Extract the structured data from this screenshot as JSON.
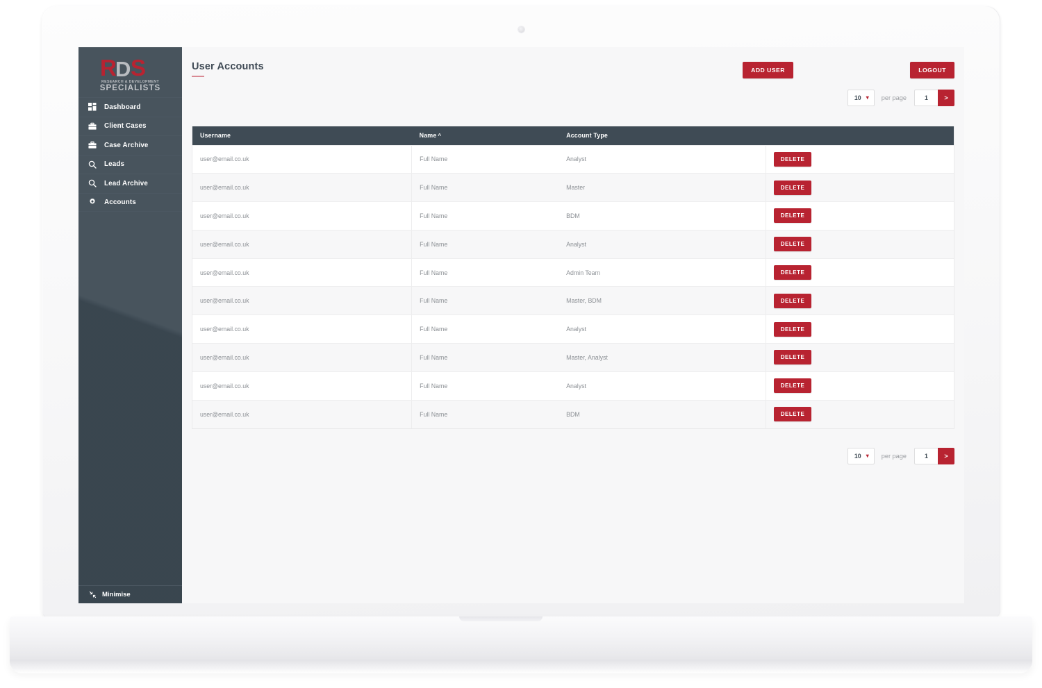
{
  "brand": {
    "logo_letters": "RDS",
    "tagline_line1": "RESEARCH & DEVELOPMENT",
    "tagline_line2": "SPECIALISTS",
    "red": "#b82331",
    "gray": "#b9bcc0",
    "sidebar_bg": "#3d4a54"
  },
  "sidebar": {
    "items": [
      {
        "label": "Dashboard",
        "icon": "grid-icon"
      },
      {
        "label": "Client Cases",
        "icon": "briefcase-icon"
      },
      {
        "label": "Case Archive",
        "icon": "briefcase-icon"
      },
      {
        "label": "Leads",
        "icon": "search-icon"
      },
      {
        "label": "Lead Archive",
        "icon": "search-icon"
      },
      {
        "label": "Accounts",
        "icon": "gear-icon"
      }
    ],
    "minimise_label": "Minimise",
    "minimise_icon": "collapse-arrows-icon"
  },
  "header": {
    "title": "User Accounts",
    "add_user_label": "ADD USER",
    "logout_label": "LOGOUT"
  },
  "pagination": {
    "per_page_value": "10",
    "per_page_label": "per page",
    "page_value": "1",
    "next_label": ">",
    "chevron_icon": "chevron-down-icon"
  },
  "table": {
    "columns": [
      {
        "label": "Username",
        "sorted": false
      },
      {
        "label": "Name",
        "sorted": true,
        "sort_caret": "^"
      },
      {
        "label": "Account Type",
        "sorted": false
      },
      {
        "label": "",
        "sorted": false
      }
    ],
    "delete_label": "DELETE",
    "rows": [
      {
        "username": "user@email.co.uk",
        "name": "Full Name",
        "type": "Analyst"
      },
      {
        "username": "user@email.co.uk",
        "name": "Full Name",
        "type": "Master"
      },
      {
        "username": "user@email.co.uk",
        "name": "Full Name",
        "type": "BDM"
      },
      {
        "username": "user@email.co.uk",
        "name": "Full Name",
        "type": "Analyst"
      },
      {
        "username": "user@email.co.uk",
        "name": "Full Name",
        "type": "Admin Team"
      },
      {
        "username": "user@email.co.uk",
        "name": "Full Name",
        "type": "Master, BDM"
      },
      {
        "username": "user@email.co.uk",
        "name": "Full Name",
        "type": "Analyst"
      },
      {
        "username": "user@email.co.uk",
        "name": "Full Name",
        "type": "Master, Analyst"
      },
      {
        "username": "user@email.co.uk",
        "name": "Full Name",
        "type": "Analyst"
      },
      {
        "username": "user@email.co.uk",
        "name": "Full Name",
        "type": "BDM"
      }
    ]
  }
}
